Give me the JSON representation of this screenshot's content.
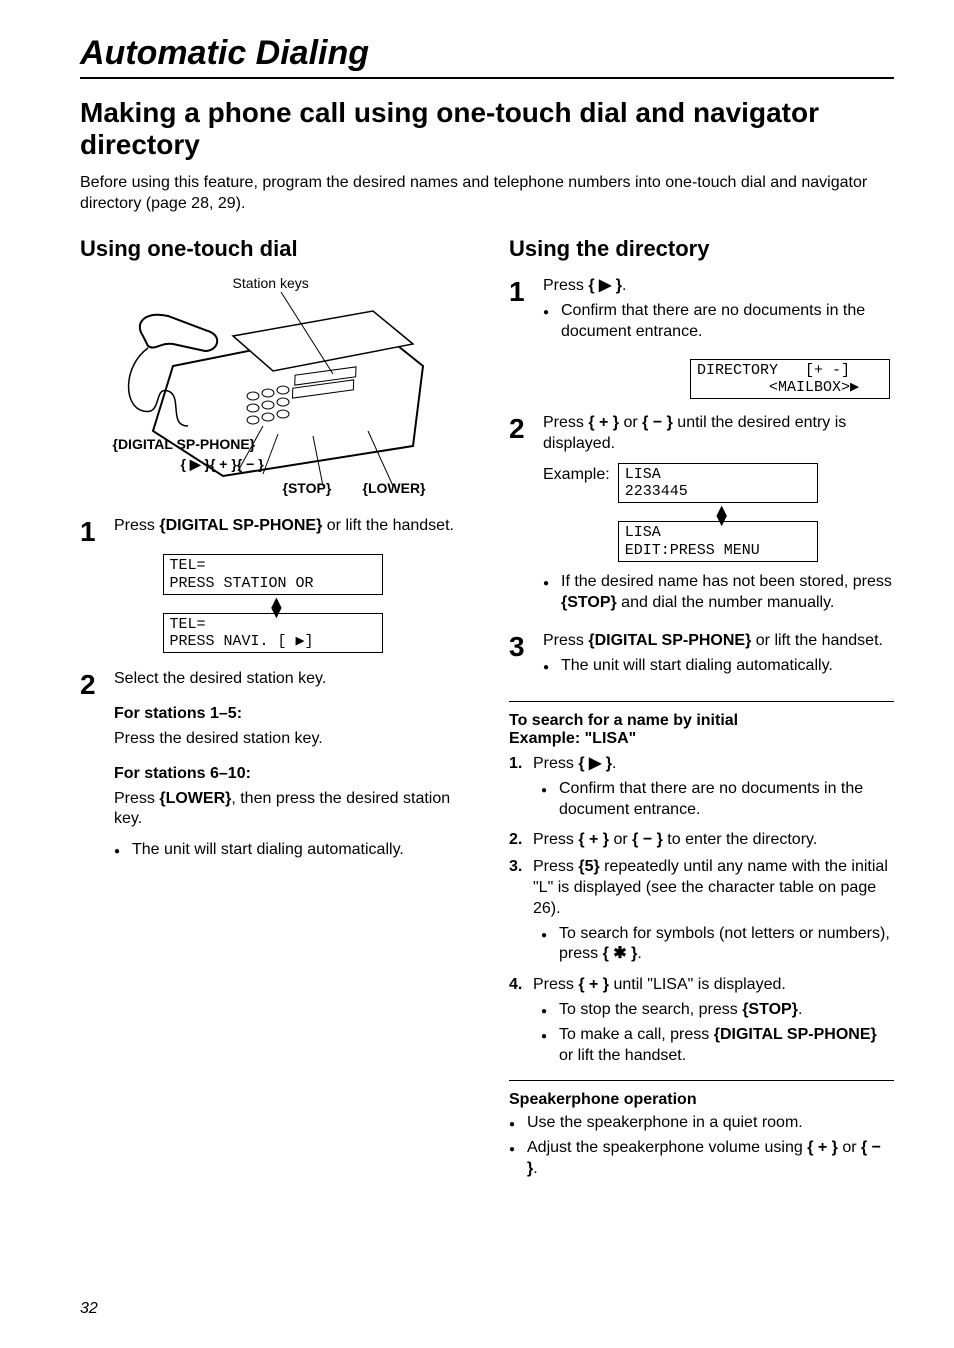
{
  "pageNumber": "32",
  "chapter": "Automatic Dialing",
  "heading": "Making a phone call using one-touch dial and navigator directory",
  "intro": "Before using this feature, program the desired names and telephone numbers into one-touch dial and navigator directory (page 28, 29).",
  "left": {
    "heading": "Using one-touch dial",
    "diagram": {
      "stationKeys": "Station keys",
      "digitalSpPhone": "{DIGITAL SP-PHONE}",
      "navKeys": "{ ▶ }{ + }{ − }",
      "stop": "{STOP}",
      "lower": "{LOWER}"
    },
    "step1_before": "Press ",
    "step1_key": "{DIGITAL SP-PHONE}",
    "step1_after": " or lift the handset.",
    "lcd1a": "TEL=\nPRESS STATION OR",
    "lcd1b": "TEL=\nPRESS NAVI. [ ▶]",
    "step2": "Select the desired station key.",
    "sub1_title": "For stations 1–5:",
    "sub1_body": "Press the desired station key.",
    "sub2_title": "For stations 6–10:",
    "sub2_body_before": "Press ",
    "sub2_body_key": "{LOWER}",
    "sub2_body_after": ", then press the desired station key.",
    "sub2_bullet": "The unit will start dialing automatically."
  },
  "right": {
    "heading": "Using the directory",
    "step1_before": "Press ",
    "step1_key": "{ ▶ }",
    "step1_after": ".",
    "step1_bullet": "Confirm that there are no documents in the document entrance.",
    "lcd1": "DIRECTORY   [+ -]\n        <MAILBOX>▶",
    "step2_before": "Press ",
    "step2_keyA": "{ + }",
    "step2_mid": " or ",
    "step2_keyB": "{ − }",
    "step2_after": " until the desired entry is displayed.",
    "exampleLabel": "Example:",
    "lcd2a": "LISA\n2233445",
    "lcd2b": "LISA\nEDIT:PRESS MENU",
    "step2_bullet_before": "If the desired name has not been stored, press ",
    "step2_bullet_key": "{STOP}",
    "step2_bullet_after": " and dial the number manually.",
    "step3_before": "Press ",
    "step3_key": "{DIGITAL SP-PHONE}",
    "step3_after": " or lift the handset.",
    "step3_bullet": "The unit will start dialing automatically.",
    "searchTitle": "To search for a name by initial",
    "searchExample": "Example: \"LISA\"",
    "s1_before": "Press ",
    "s1_key": "{ ▶ }",
    "s1_after": ".",
    "s1_bullet": "Confirm that there are no documents in the document entrance.",
    "s2_before": "Press ",
    "s2_keyA": "{ + }",
    "s2_mid": " or ",
    "s2_keyB": "{ − }",
    "s2_after": " to enter the directory.",
    "s3_before": "Press ",
    "s3_key": "{5}",
    "s3_after": " repeatedly until any name with the initial \"L\" is displayed (see the character table on page 26).",
    "s3_bullet_before": "To search for symbols (not letters or numbers), press ",
    "s3_bullet_key": "{ ✱ }",
    "s3_bullet_after": ".",
    "s4_before": "Press ",
    "s4_key": "{ + }",
    "s4_after": " until \"LISA\" is displayed.",
    "s4_bullet1_before": "To stop the search, press ",
    "s4_bullet1_key": "{STOP}",
    "s4_bullet1_after": ".",
    "s4_bullet2_before": "To make a call, press ",
    "s4_bullet2_key": "{DIGITAL SP-PHONE}",
    "s4_bullet2_after": " or lift the handset.",
    "speakerTitle": "Speakerphone operation",
    "sp_bullet1": "Use the speakerphone in a quiet room.",
    "sp_bullet2_before": "Adjust the speakerphone volume using ",
    "sp_bullet2_keyA": "{ + }",
    "sp_bullet2_mid": " or ",
    "sp_bullet2_keyB": "{ − }",
    "sp_bullet2_after": "."
  }
}
